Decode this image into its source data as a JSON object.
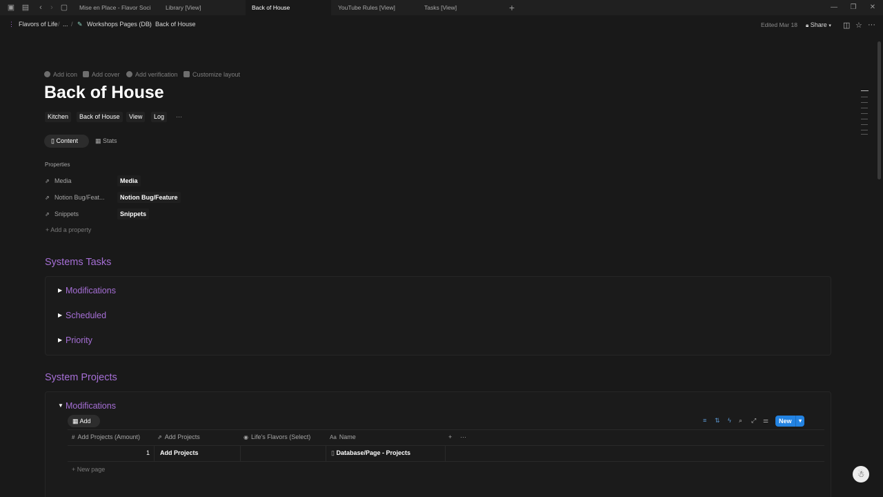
{
  "tabs": [
    {
      "label": "Mise en Place - Flavor Societ"
    },
    {
      "label": "Library [View]"
    },
    {
      "label": "Back of House"
    },
    {
      "label": "YouTube Rules [View]"
    },
    {
      "label": "Tasks [View]"
    }
  ],
  "breadcrumb": {
    "workspace": "Flavors of Life",
    "ellipsis": "...",
    "parent": "Workshops Pages (DB)",
    "current": "Back of House"
  },
  "topbar": {
    "edited": "Edited Mar 18",
    "share": "Share"
  },
  "page_actions": {
    "add_icon": "Add icon",
    "add_cover": "Add cover",
    "add_verification": "Add verification",
    "customize_layout": "Customize layout"
  },
  "title": "Back of House",
  "tags": [
    "Kitchen",
    "Back of House",
    "View",
    "Log"
  ],
  "content_tabs": {
    "content": "Content",
    "stats": "Stats"
  },
  "properties": {
    "heading": "Properties",
    "items": [
      {
        "label": "Media",
        "value": "Media"
      },
      {
        "label": "Notion Bug/Feat...",
        "value": "Notion Bug/Feature"
      },
      {
        "label": "Snippets",
        "value": "Snippets"
      }
    ],
    "add": "Add a property"
  },
  "systems_tasks": {
    "heading": "Systems Tasks",
    "toggles": [
      "Modifications",
      "Scheduled",
      "Priority"
    ]
  },
  "system_projects": {
    "heading": "System Projects",
    "toggle": "Modifications",
    "add_view": "Add",
    "new_button": "New",
    "columns": [
      "Add Projects (Amount)",
      "Add Projects",
      "Life's Flavors (Select)",
      "Name"
    ],
    "rows": [
      {
        "amount": "1",
        "projects": "Add Projects",
        "flavors": "",
        "name": "Database/Page - Projects"
      }
    ],
    "new_page": "New page"
  }
}
